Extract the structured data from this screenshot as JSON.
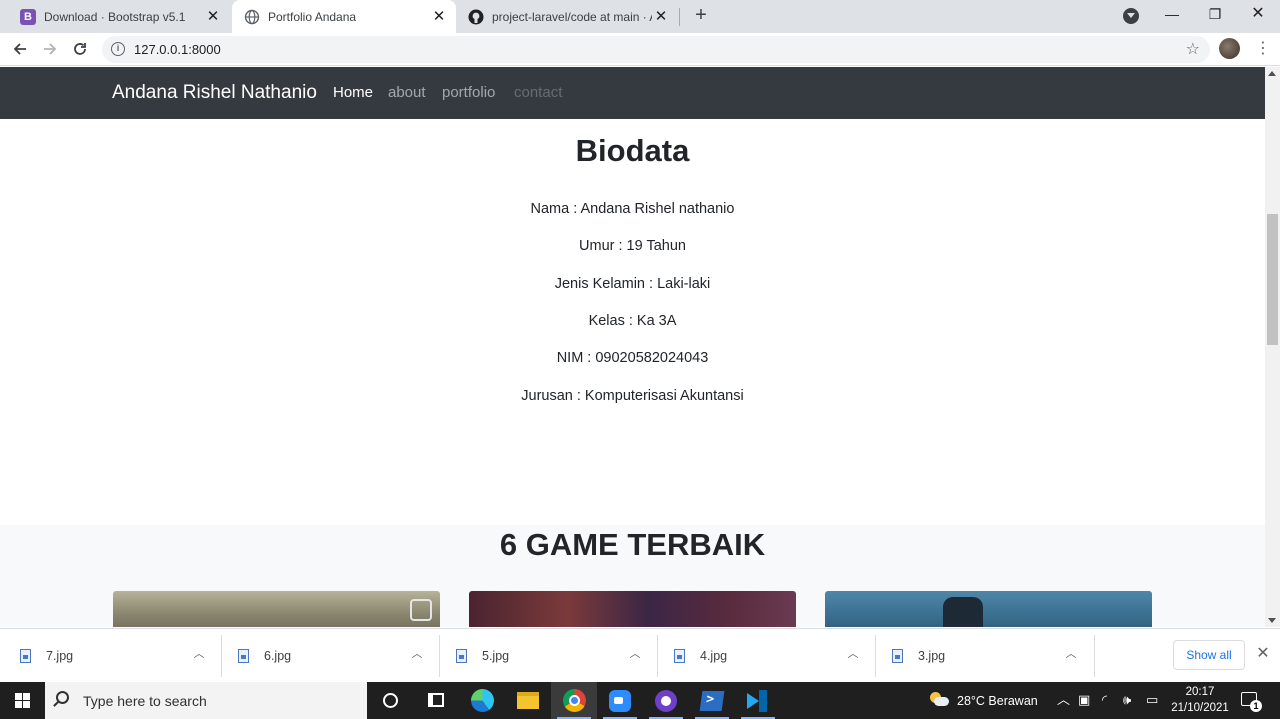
{
  "browser": {
    "tabs": [
      {
        "title": "Download · Bootstrap v5.1",
        "favicon": "bootstrap-icon",
        "active": false
      },
      {
        "title": "Portfolio Andana",
        "favicon": "globe-icon",
        "active": true
      },
      {
        "title": "project-laravel/code at main · An",
        "favicon": "github-icon",
        "active": false
      }
    ],
    "new_tab_label": "+",
    "url": "127.0.0.1:8000"
  },
  "site": {
    "brand": "Andana Rishel Nathanio",
    "nav": [
      {
        "label": "Home",
        "state": "active"
      },
      {
        "label": "about",
        "state": "normal"
      },
      {
        "label": "portfolio",
        "state": "normal"
      },
      {
        "label": "contact",
        "state": "disabled"
      }
    ],
    "biodata": {
      "title": "Biodata",
      "lines": [
        "Nama : Andana Rishel nathanio",
        "Umur : 19 Tahun",
        "Jenis Kelamin : Laki-laki",
        "Kelas : Ka 3A",
        "NIM : 09020582024043",
        "Jurusan : Komputerisasi Akuntansi"
      ]
    },
    "games": {
      "title": "6 GAME TERBAIK"
    }
  },
  "downloads": {
    "items": [
      "7.jpg",
      "6.jpg",
      "5.jpg",
      "4.jpg",
      "3.jpg"
    ],
    "show_all": "Show all"
  },
  "taskbar": {
    "search_placeholder": "Type here to search",
    "weather": "28°C  Berawan",
    "time": "20:17",
    "date": "21/10/2021",
    "notifications": "1"
  },
  "colors": {
    "navbar": "#343a40",
    "section_alt": "#f8f9fa",
    "link_blue": "#1a73e8"
  }
}
